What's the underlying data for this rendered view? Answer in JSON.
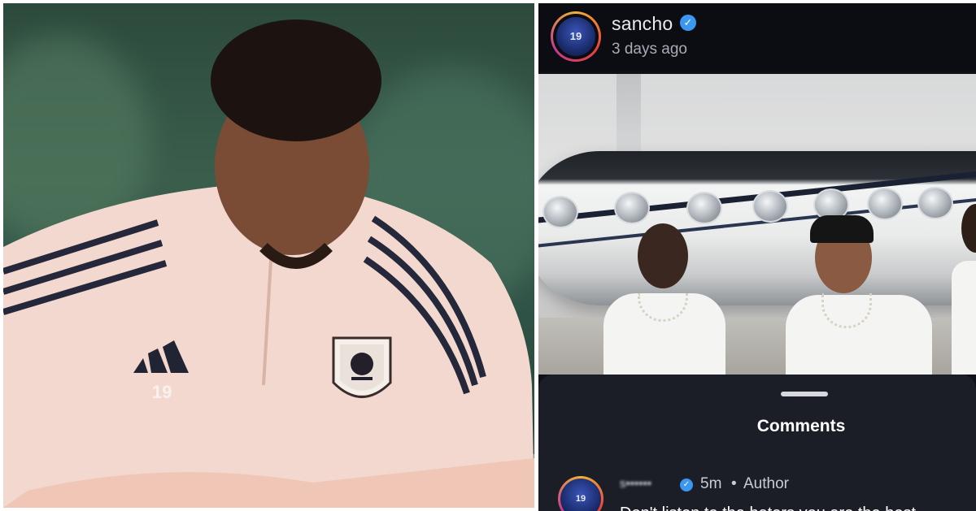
{
  "post": {
    "username": "sancho",
    "time_ago": "3 days ago",
    "avatar_number": "19"
  },
  "comments": {
    "title": "Comments",
    "items": [
      {
        "username": "s••••••",
        "time": "5m",
        "separator": "•",
        "role": "Author",
        "text": "Don't listen to the haters you are the best",
        "avatar_number": "19"
      }
    ]
  },
  "photo": {
    "jersey_number": "19"
  },
  "colors": {
    "verified_blue": "#3b97f0",
    "sheet_background": "#1b1e27",
    "header_background": "#0b0d12"
  },
  "icons": {
    "verified": "verified-badge-icon"
  }
}
